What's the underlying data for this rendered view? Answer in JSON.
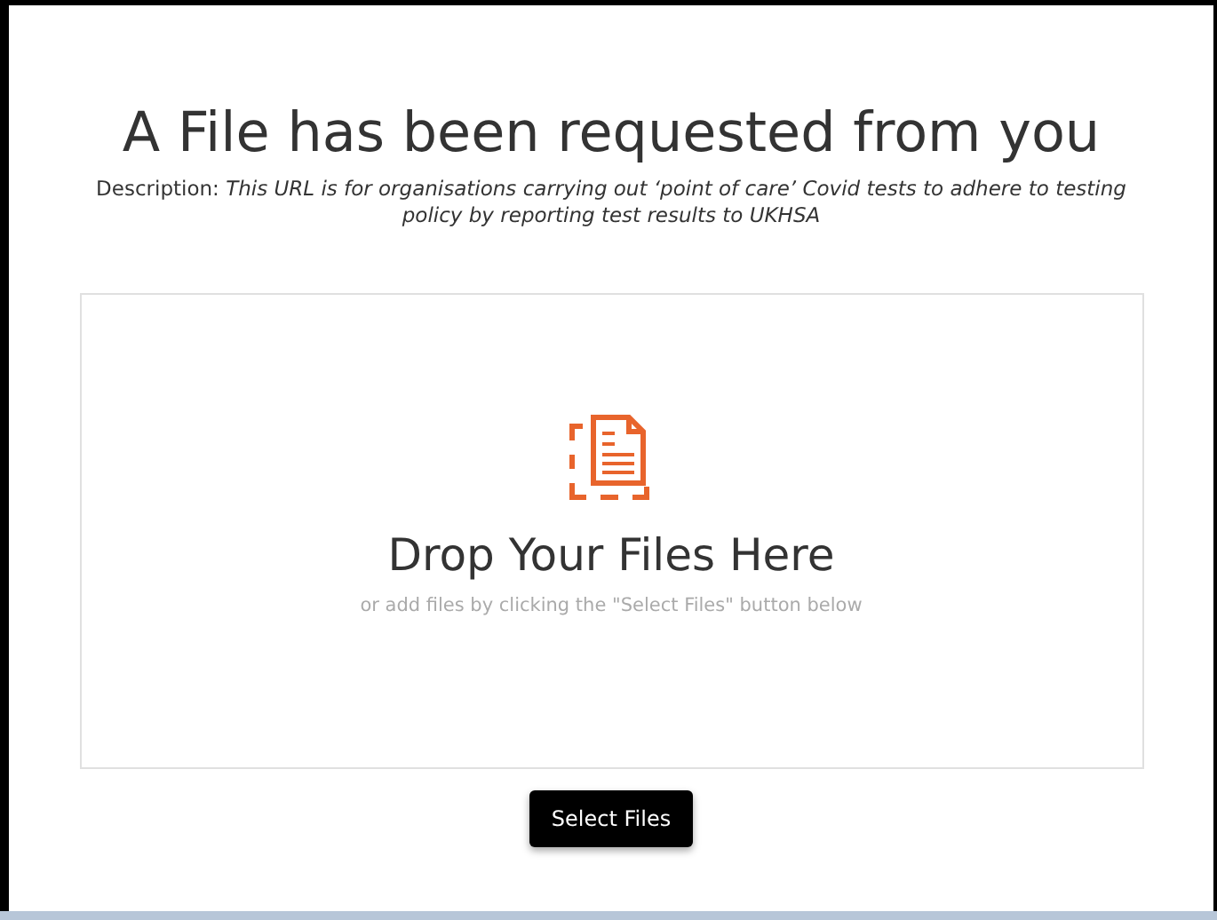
{
  "title": "A File has been requested from you",
  "description": "Description: *This URL is for organisations carrying out ‘point of care’ Covid tests to adhere to testing policy by reporting test results to UKHSA*",
  "dropzone": {
    "heading": "Drop Your Files Here",
    "hint": "or add files by clicking the \"Select Files\" button below"
  },
  "button": "Select Files"
}
